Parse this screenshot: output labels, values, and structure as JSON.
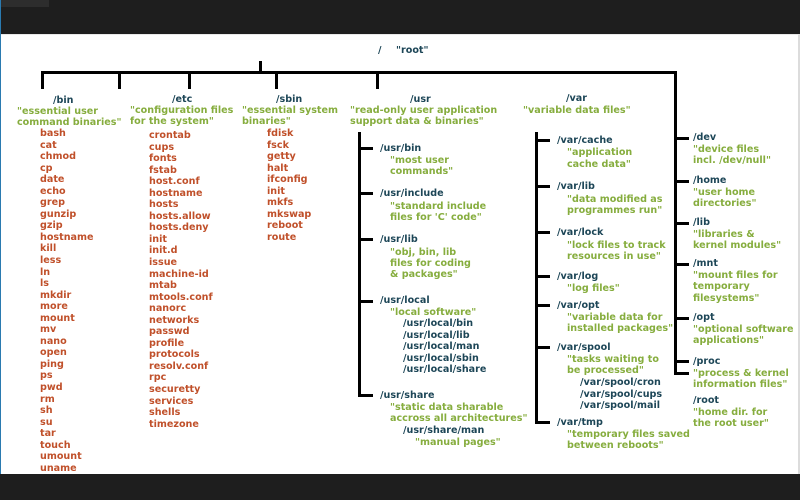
{
  "root": {
    "path": "/",
    "label": "\"root\""
  },
  "bin": {
    "path": "/bin",
    "desc": [
      "\"essential user",
      "command binaries\""
    ],
    "files": [
      "bash",
      "cat",
      "chmod",
      "cp",
      "date",
      "echo",
      "grep",
      "gunzip",
      "gzip",
      "hostname",
      "kill",
      "less",
      "ln",
      "ls",
      "mkdir",
      "more",
      "mount",
      "mv",
      "nano",
      "open",
      "ping",
      "ps",
      "pwd",
      "rm",
      "sh",
      "su",
      "tar",
      "touch",
      "umount",
      "uname"
    ]
  },
  "etc": {
    "path": "/etc",
    "desc": [
      "\"configuration files",
      "for the system\""
    ],
    "files": [
      "crontab",
      "cups",
      "fonts",
      "fstab",
      "host.conf",
      "hostname",
      "hosts",
      "hosts.allow",
      "hosts.deny",
      "init",
      "init.d",
      "issue",
      "machine-id",
      "mtab",
      "mtools.conf",
      "nanorc",
      "networks",
      "passwd",
      "profile",
      "protocols",
      "resolv.conf",
      "rpc",
      "securetty",
      "services",
      "shells",
      "timezone"
    ]
  },
  "sbin": {
    "path": "/sbin",
    "desc": [
      "\"essential system",
      "binaries\""
    ],
    "files": [
      "fdisk",
      "fsck",
      "getty",
      "halt",
      "ifconfig",
      "init",
      "mkfs",
      "mkswap",
      "reboot",
      "route"
    ]
  },
  "usr": {
    "path": "/usr",
    "desc": [
      "\"read-only user application",
      "support data & binaries\""
    ],
    "children": [
      {
        "path": "/usr/bin",
        "desc": [
          "\"most user",
          "commands\""
        ]
      },
      {
        "path": "/usr/include",
        "desc": [
          "\"standard include",
          "files for 'C' code\""
        ]
      },
      {
        "path": "/usr/lib",
        "desc": [
          "\"obj, bin, lib",
          "files for coding",
          "& packages\""
        ]
      },
      {
        "path": "/usr/local",
        "desc": [
          "\"local software\""
        ],
        "subdirs": [
          "/usr/local/bin",
          "/usr/local/lib",
          "/usr/local/man",
          "/usr/local/sbin",
          "/usr/local/share"
        ]
      },
      {
        "path": "/usr/share",
        "desc": [
          "\"static data sharable",
          "accross all architectures\""
        ],
        "subdir": "/usr/share/man",
        "subdir_desc": "\"manual pages\""
      }
    ]
  },
  "var": {
    "path": "/var",
    "desc": [
      "\"variable data files\""
    ],
    "children": [
      {
        "path": "/var/cache",
        "desc": [
          "\"application",
          "cache data\""
        ]
      },
      {
        "path": "/var/lib",
        "desc": [
          "\"data modified as",
          "programmes run\""
        ]
      },
      {
        "path": "/var/lock",
        "desc": [
          "\"lock files to track",
          "resources in use\""
        ]
      },
      {
        "path": "/var/log",
        "desc": [
          "\"log files\""
        ]
      },
      {
        "path": "/var/opt",
        "desc": [
          "\"variable data for",
          "installed packages\""
        ]
      },
      {
        "path": "/var/spool",
        "desc": [
          "\"tasks waiting to",
          "be processed\""
        ],
        "subdirs": [
          "/var/spool/cron",
          "/var/spool/cups",
          "/var/spool/mail"
        ]
      },
      {
        "path": "/var/tmp",
        "desc": [
          "\"temporary files saved",
          "between reboots\""
        ]
      }
    ]
  },
  "others": [
    {
      "path": "/dev",
      "desc": [
        "\"device files",
        "incl. /dev/null\""
      ]
    },
    {
      "path": "/home",
      "desc": [
        "\"user home",
        "directories\""
      ]
    },
    {
      "path": "/lib",
      "desc": [
        "\"libraries &",
        "kernel modules\""
      ]
    },
    {
      "path": "/mnt",
      "desc": [
        "\"mount files for",
        "temporary",
        "filesystems\""
      ]
    },
    {
      "path": "/opt",
      "desc": [
        "\"optional software",
        "applications\""
      ]
    },
    {
      "path": "/proc",
      "desc": [
        "\"process & kernel",
        "information files\""
      ]
    },
    {
      "path": "/root",
      "desc": [
        "\"home dir. for",
        "the root user\""
      ]
    }
  ]
}
